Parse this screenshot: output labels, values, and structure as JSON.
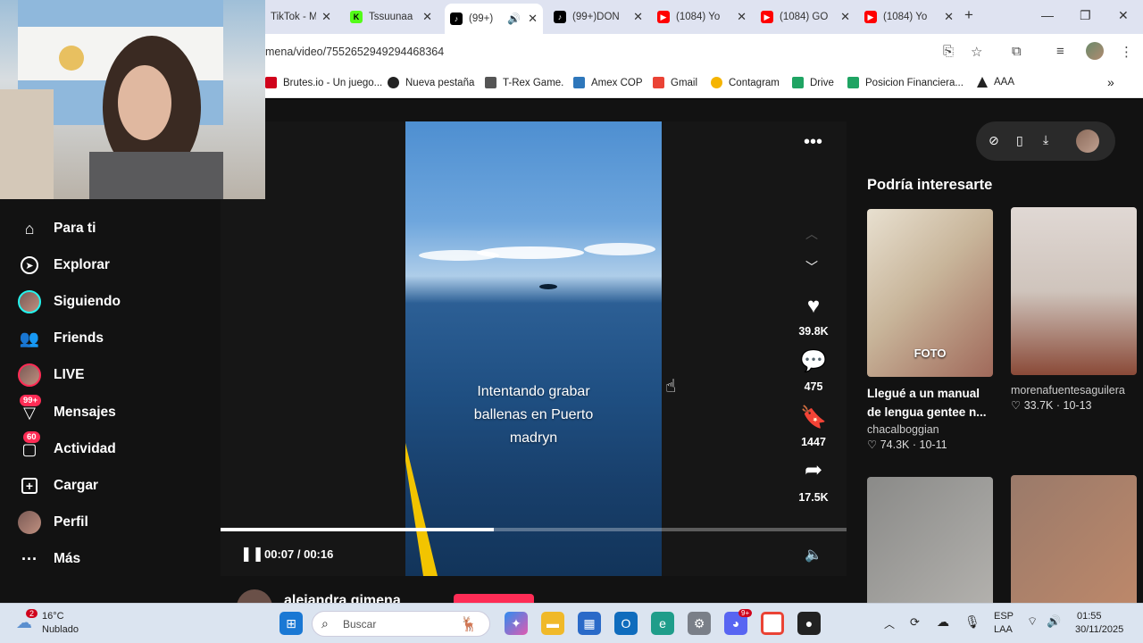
{
  "browser": {
    "tabs": [
      {
        "label": "TikTok - M",
        "color": "#000000",
        "icon": "tiktok-icon"
      },
      {
        "label": "Tssuunaa",
        "color": "#53fc18",
        "icon": "kick-icon"
      },
      {
        "label": "(99+)",
        "color": "#000000",
        "icon": "tiktok-icon",
        "active": true
      },
      {
        "label": "(99+)DON",
        "color": "#000000",
        "icon": "tiktok-icon"
      },
      {
        "label": "(1084) Yo",
        "color": "#ff0000",
        "icon": "youtube-icon"
      },
      {
        "label": "(1084) GO",
        "color": "#ff0000",
        "icon": "youtube-icon"
      },
      {
        "label": "(1084) Yo",
        "color": "#ff0000",
        "icon": "youtube-icon"
      }
    ],
    "url": "mena/video/7552652949294468364",
    "bookmarks": [
      {
        "label": "Brutes.io - Un juego...",
        "color": "#d0021b"
      },
      {
        "label": "Nueva pestaña",
        "color": "#222222"
      },
      {
        "label": "T-Rex Game.",
        "color": "#555555"
      },
      {
        "label": "Amex COP",
        "color": "#2e77bb"
      },
      {
        "label": "Gmail",
        "color": "#ea4335"
      },
      {
        "label": "Contagram",
        "color": "#f5b400"
      },
      {
        "label": "Drive",
        "color": "#1fa463"
      },
      {
        "label": "Posicion Financiera...",
        "color": "#1fa463"
      },
      {
        "label": "AAA",
        "color": "#222222"
      }
    ]
  },
  "sidebar": {
    "items": [
      {
        "label": "Para ti",
        "icon": "home-icon"
      },
      {
        "label": "Explorar",
        "icon": "compass-icon"
      },
      {
        "label": "Siguiendo",
        "icon": "avatar-icon"
      },
      {
        "label": "Friends",
        "icon": "friends-icon"
      },
      {
        "label": "LIVE",
        "icon": "live-icon"
      },
      {
        "label": "Mensajes",
        "icon": "inbox-icon",
        "badge": "99+"
      },
      {
        "label": "Actividad",
        "icon": "activity-icon",
        "badge": "60"
      },
      {
        "label": "Cargar",
        "icon": "upload-icon"
      },
      {
        "label": "Perfil",
        "icon": "profile-icon"
      },
      {
        "label": "Más",
        "icon": "more-icon"
      }
    ]
  },
  "player": {
    "caption_lines": [
      "Intentando grabar",
      "ballenas en Puerto",
      "madryn"
    ],
    "time": "00:07 / 00:16",
    "progress": 0.437,
    "likes": "39.8K",
    "comments": "475",
    "saves": "1447",
    "shares": "17.5K",
    "author_partial": "alejandra gimena"
  },
  "suggestions": {
    "title": "Podría interesarte",
    "cards": [
      {
        "title": "Llegué a un manual de lengua gentee n...",
        "user": "chacalboggian",
        "likes": "74.3K",
        "date": "10-11",
        "overlay": "FOTO"
      },
      {
        "title": "",
        "user": "morenafuentesaguilera",
        "likes": "33.7K",
        "date": "10-13"
      },
      {
        "title": "",
        "user": "",
        "likes": "",
        "date": ""
      },
      {
        "title": "",
        "user": "",
        "likes": "",
        "date": ""
      }
    ]
  },
  "taskbar": {
    "weather_temp": "16°C",
    "weather_desc": "Nublado",
    "weather_badge": "2",
    "search_placeholder": "Buscar",
    "lang1": "ESP",
    "lang2": "LAA",
    "time": "01:55",
    "date": "30/11/2025",
    "discord_badge": "9+"
  }
}
